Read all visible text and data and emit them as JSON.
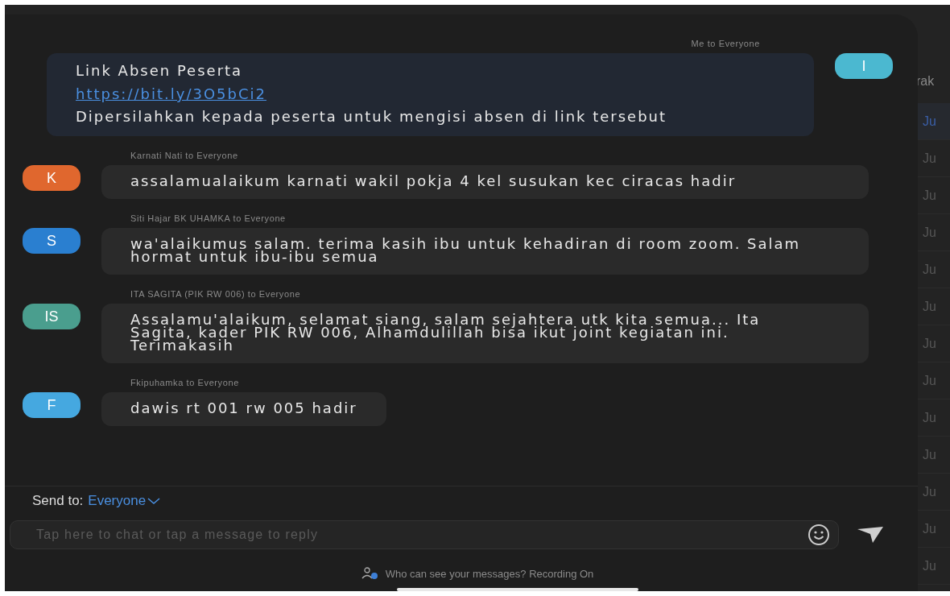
{
  "messages": [
    {
      "kind": "mine",
      "sender": "Me to Everyone",
      "avatar": "I",
      "color": "#4bb8d0",
      "parts": [
        {
          "kind": "text",
          "text": "Link Absen Peserta"
        },
        {
          "kind": "link",
          "text": "https://bit.ly/3O5bCi2"
        },
        {
          "kind": "text",
          "text": "Dipersilahkan kepada peserta untuk mengisi absen di link tersebut"
        }
      ]
    },
    {
      "kind": "other",
      "sender": "Karnati Nati to Everyone",
      "avatar": "K",
      "color": "#e0672e",
      "text": "assalamualaikum karnati wakil pokja 4 kel susukan kec ciracas hadir"
    },
    {
      "kind": "other",
      "sender": "Siti Hajar BK UHAMKA to Everyone",
      "avatar": "S",
      "color": "#2a7fd0",
      "text": "wa'alaikumus salam. terima kasih ibu untuk kehadiran di room zoom. Salam hormat untuk ibu-ibu semua"
    },
    {
      "kind": "other",
      "sender": "ITA SAGITA (PIK RW 006) to Everyone",
      "avatar": "IS",
      "color": "#4a9e8e",
      "text": "Assalamu'alaikum, selamat siang, salam sejahtera utk kita semua... Ita Sagita, kader PIK RW 006, Alhamdulillah bisa ikut joint kegiatan ini. Terimakasih"
    },
    {
      "kind": "other",
      "sender": "Fkipuhamka to Everyone",
      "avatar": "F",
      "color": "#45a8e0",
      "text": "dawis rt 001 rw 005 hadir"
    }
  ],
  "composer": {
    "send_to_label": "Send to:",
    "recipient": "Everyone",
    "placeholder": "Tap here to chat or tap a message to reply"
  },
  "footer": {
    "text": "Who can see your messages? Recording On"
  },
  "background_app": {
    "heading": "rak",
    "items": [
      {
        "text": "Ju",
        "selected": true
      },
      {
        "text": "Ju",
        "selected": false
      },
      {
        "text": "Ju",
        "selected": false
      },
      {
        "text": "Ju",
        "selected": false
      },
      {
        "text": "Ju",
        "selected": false
      },
      {
        "text": "Ju",
        "selected": false
      },
      {
        "text": "Ju",
        "selected": false
      },
      {
        "text": "Ju",
        "selected": false
      },
      {
        "text": "Ju",
        "selected": false
      },
      {
        "text": "Ju",
        "selected": false
      },
      {
        "text": "Ju",
        "selected": false
      },
      {
        "text": "Ju",
        "selected": false
      },
      {
        "text": "Ju",
        "selected": false
      }
    ]
  }
}
